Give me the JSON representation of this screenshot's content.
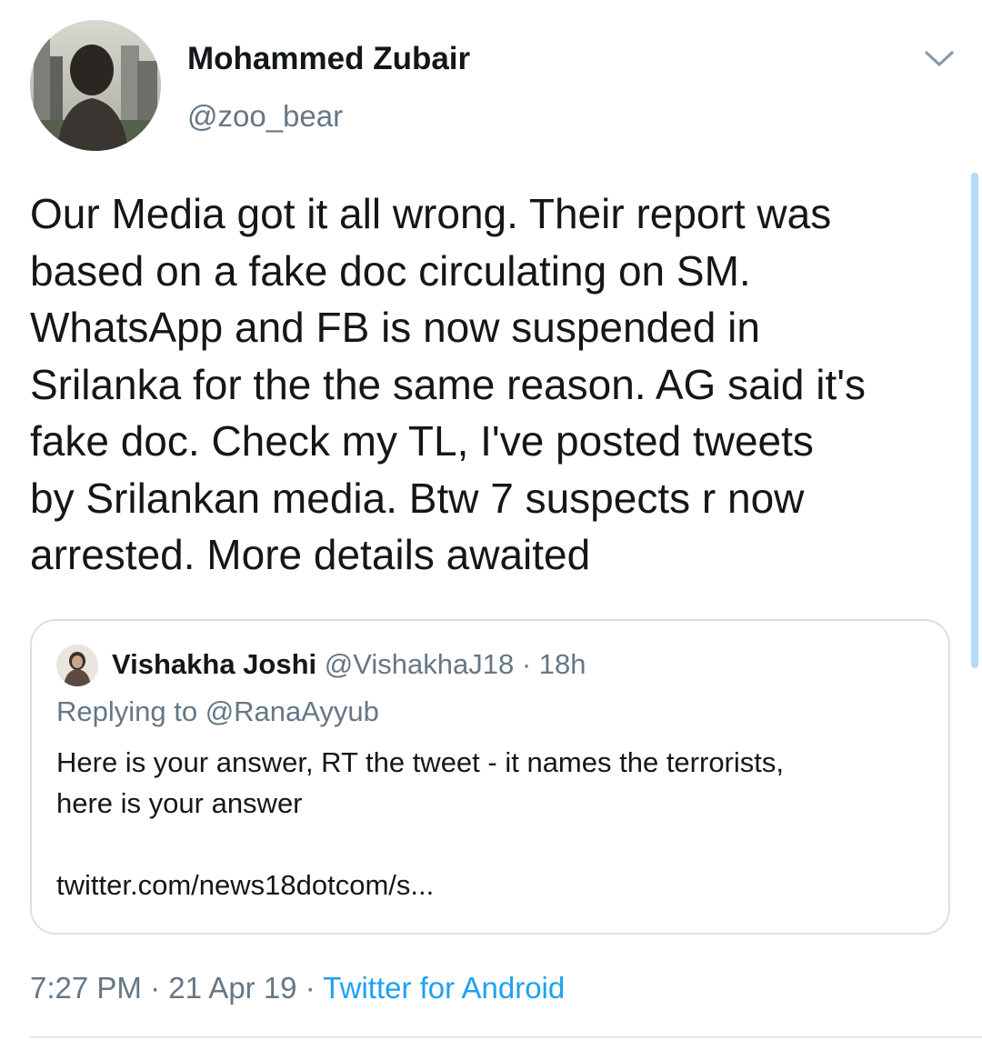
{
  "author": {
    "display_name": "Mohammed Zubair",
    "handle": "@zoo_bear"
  },
  "tweet": {
    "lines": [
      "Our Media got it all wrong. Their report was",
      "based on a fake doc circulating on SM.",
      "WhatsApp and FB is now suspended in",
      "Srilanka for the the same reason. AG said it's",
      "fake doc. Check my TL, I've posted tweets",
      "by Srilankan media. Btw 7 suspects r now",
      "arrested. More details awaited"
    ]
  },
  "quoted_tweet": {
    "display_name": "Vishakha Joshi",
    "handle": "@VishakhaJ18",
    "separator": "·",
    "time": "18h",
    "replying_to": "Replying to @RanaAyyub",
    "body_lines": [
      "Here is your answer, RT the tweet - it names the terrorists,",
      "here is your answer"
    ],
    "link": "twitter.com/news18dotcom/s..."
  },
  "meta": {
    "time": "7:27 PM",
    "separator": "·",
    "date": "21 Apr 19",
    "source": "Twitter for Android"
  },
  "icons": {
    "menu": "chevron-down-icon"
  },
  "colors": {
    "text_primary": "#14171a",
    "text_secondary": "#657786",
    "accent": "#1da1f2",
    "border": "#d9e0e6"
  }
}
